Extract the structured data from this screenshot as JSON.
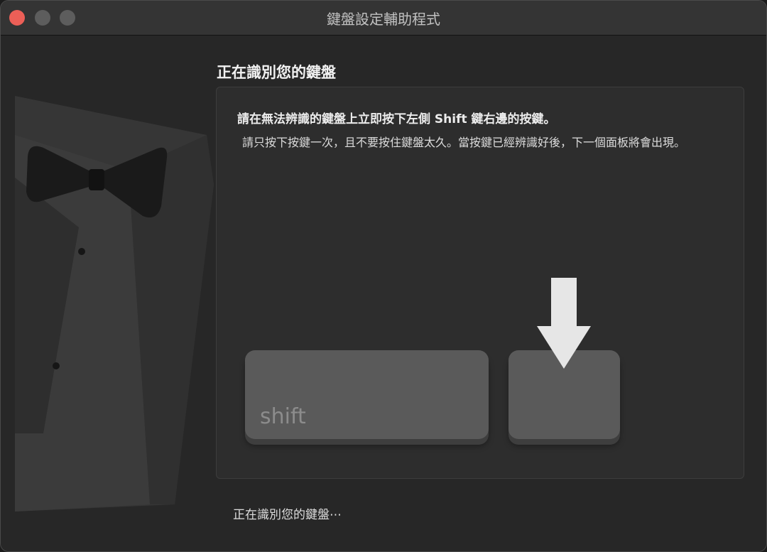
{
  "window": {
    "title": "鍵盤設定輔助程式"
  },
  "page": {
    "heading": "正在識別您的鍵盤",
    "instruction": "請在無法辨識的鍵盤上立即按下左側 Shift 鍵右邊的按鍵。",
    "subtext": "請只按下按鍵一次，且不要按住鍵盤太久。當按鍵已經辨識好後，下一個面板將會出現。",
    "shift_key_label": "shift",
    "status": "正在識別您的鍵盤⋯"
  },
  "icons": {
    "illustration": "tuxedo-illustration",
    "pointer": "down-arrow-icon"
  },
  "colors": {
    "close": "#ec5f57",
    "inactive_light": "#5d5d5d",
    "key": "#5a5a5a"
  }
}
